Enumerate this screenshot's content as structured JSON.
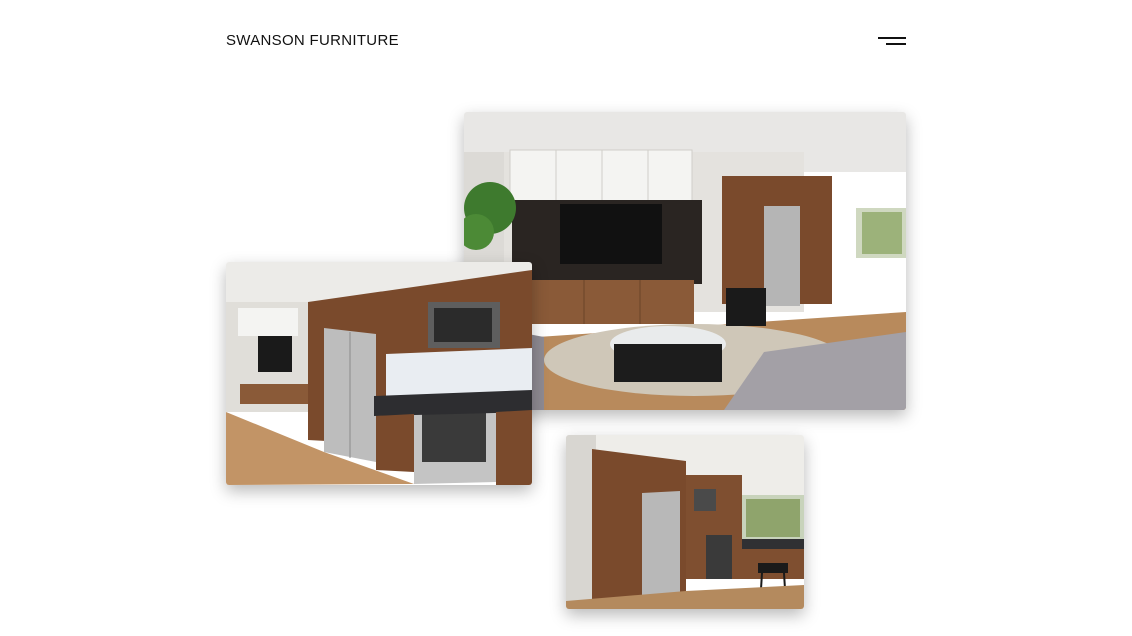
{
  "header": {
    "brand": "SWANSON FURNITURE",
    "menu_icon": "hamburger-menu-icon"
  },
  "gallery": {
    "photos": [
      {
        "subject": "living-room-photo"
      },
      {
        "subject": "kitchen-photo"
      },
      {
        "subject": "kitchen-corner-photo"
      }
    ]
  },
  "colors": {
    "brand_text": "#111111",
    "background": "#ffffff",
    "wood": "#7a4a2c"
  }
}
